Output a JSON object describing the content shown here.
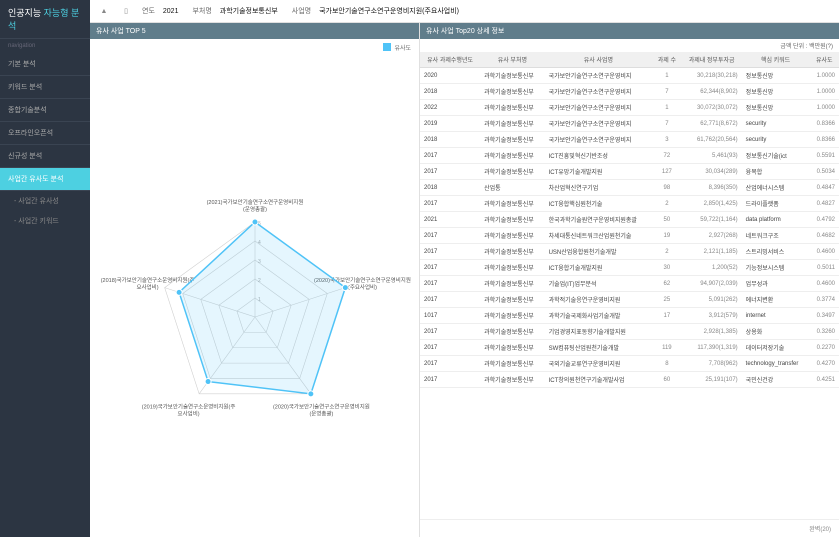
{
  "brand": {
    "a": "인공지능",
    "b": "자능형 분석"
  },
  "navLabel": "navigation",
  "nav": {
    "items": [
      "기본 분석",
      "키워드 분석",
      "종합기술분석",
      "오프라인오픈석",
      "신규성 분석",
      "사업간 유사도 분석"
    ],
    "activeIndex": 5,
    "subItems": [
      "사업간 유사성",
      "사업간 키워드"
    ]
  },
  "topbar": {
    "yearLabel": "연도",
    "year": "2021",
    "deptLabel": "부처명",
    "dept": "과학기술정보통신부",
    "bizLabel": "사업명",
    "biz": "국가보안기술연구소연구운영비지원(주요사업비)"
  },
  "leftHeader": "유사 사업 TOP 5",
  "legend": "유사도",
  "rightHeader": "유사 사업 Top20 상세 정보",
  "rightSubtext": "금액 단위 : 백만원(?)",
  "table": {
    "headers": [
      "유사 과제수행년도",
      "유사 부처명",
      "유사 사업명",
      "과제 수",
      "과제내 정부투자금",
      "핵심 키워드",
      "유사도"
    ],
    "rows": [
      [
        "2020",
        "과학기술정보통신부",
        "국가보안기술연구소연구운영비지",
        "1",
        "30,218(30,218)",
        "정보통신망",
        "1.0000"
      ],
      [
        "2018",
        "과학기술정보통신부",
        "국가보안기술연구소연구운영비지",
        "7",
        "62,344(8,902)",
        "정보통신망",
        "1.0000"
      ],
      [
        "2022",
        "과학기술정보통신부",
        "국가보안기술연구소연구운영비지",
        "1",
        "30,072(30,072)",
        "정보통신망",
        "1.0000"
      ],
      [
        "2019",
        "과학기술정보통신부",
        "국가보안기술연구소연구운영비지",
        "7",
        "62,771(8,672)",
        "security",
        "0.8366"
      ],
      [
        "2018",
        "과학기술정보통신부",
        "국가보안기술연구소연구운영비지",
        "3",
        "61,762(20,564)",
        "security",
        "0.8366"
      ],
      [
        "2017",
        "과학기술정보통신부",
        "ICT진흥및혁신기반조성",
        "72",
        "5,461(93)",
        "정보통신기술(ict",
        "0.5591"
      ],
      [
        "2017",
        "과학기술정보통신부",
        "ICT유망기술개발지원",
        "127",
        "30,034(289)",
        "융복합",
        "0.5034"
      ],
      [
        "2018",
        "산업통",
        "차산업혁신연구기업",
        "98",
        "8,396(350)",
        "산업에너시스템",
        "0.4847"
      ],
      [
        "2017",
        "과학기술정보통신부",
        "ICT융합핵심원천기술",
        "2",
        "2,850(1,425)",
        "드라이플랫폼",
        "0.4827"
      ],
      [
        "2021",
        "과학기술정보통신부",
        "한국과학기술원연구운영비지원총괄",
        "50",
        "59,722(1,164)",
        "data platform",
        "0.4792"
      ],
      [
        "2017",
        "과학기술정보통신부",
        "차세대통신네트워크산업원천기술",
        "19",
        "2,927(268)",
        "네트워크구조",
        "0.4682"
      ],
      [
        "2017",
        "과학기술정보통신부",
        "USN산업융합원천기술개발",
        "2",
        "2,121(1,185)",
        "스트리밍서비스",
        "0.4600"
      ],
      [
        "2017",
        "과학기술정보통신부",
        "ICT융합기술개발지원",
        "30",
        "1,200(52)",
        "기능정보시스템",
        "0.5011"
      ],
      [
        "2017",
        "과학기술정보통신부",
        "기술업(IT)업무분석",
        "62",
        "94,907(2,039)",
        "업무성과",
        "0.4600"
      ],
      [
        "2017",
        "과학기술정보통신부",
        "과학적기술응연구운영비지원",
        "25",
        "5,091(262)",
        "에너지변환",
        "0.3774"
      ],
      [
        "1017",
        "과학기술정보통신부",
        "과학기술국제화사업기술개발",
        "17",
        "3,912(579)",
        "internet",
        "0.3497"
      ],
      [
        "2017",
        "과학기술정보통신부",
        "기업경영지표동향기술개발지원",
        "",
        "2,928(1,385)",
        "상용화",
        "0.3260"
      ],
      [
        "2017",
        "과학기술정보통신부",
        "SW컴퓨팅산업원천기술개발",
        "119",
        "117,390(1,319)",
        "데이터저장기술",
        "0.2270"
      ],
      [
        "2017",
        "과학기술정보통신부",
        "국외기술교류연구운영비지원",
        "8",
        "7,708(962)",
        "technology_transfer",
        "0.4270"
      ],
      [
        "2017",
        "과학기술정보통신부",
        "ICT창의원천연구기술개발사업",
        "60",
        "25,191(107)",
        "국민신건강",
        "0.4251"
      ]
    ]
  },
  "footer": "완벽(20)",
  "chart_data": {
    "type": "radar",
    "title": "",
    "axes": [
      "(2021)국가보안기술연구소연구운영비지원(운영총괄)",
      "(2020)국가보안기술연구소연구운영비지원(주요사업비)",
      "(2020)국가보안기술연구소연구운영비지원(운영총괄)",
      "(2019)국가보안기술연구소운영비지원(주요사업비)",
      "(2018)국가보안기술연구소운영비지원(주요사업비)"
    ],
    "series": [
      {
        "name": "유사도",
        "values": [
          1.0,
          1.0,
          1.0,
          0.84,
          0.84
        ]
      }
    ],
    "ticks": [
      1,
      2,
      3,
      4,
      5
    ],
    "range": [
      0,
      1
    ]
  }
}
